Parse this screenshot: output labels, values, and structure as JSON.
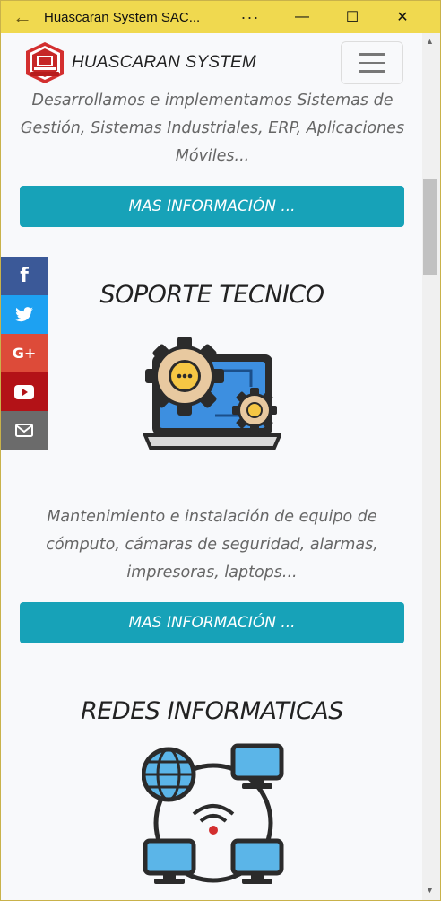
{
  "window": {
    "title": "Huascaran System SAC...",
    "more": "···",
    "minimize": "—",
    "maximize": "☐",
    "close": "✕",
    "back": "←"
  },
  "navbar": {
    "brand": "HUASCARAN SYSTEM",
    "logo_text": "HUASCARAN SYSTEM",
    "menu_icon": "hamburger-icon"
  },
  "sections": [
    {
      "description": "Desarrollamos e implementamos Sistemas de Gestión, Sistemas Industriales, ERP, Aplicaciones Móviles...",
      "button_label": "MAS INFORMACIÓN ..."
    },
    {
      "title": "SOPORTE TECNICO",
      "description": "Mantenimiento e instalación de equipo de cómputo, cámaras de seguridad, alarmas, impresoras, laptops...",
      "button_label": "MAS INFORMACIÓN ...",
      "illustration": "laptop-gears-icon"
    },
    {
      "title": "REDES INFORMATICAS",
      "illustration": "network-icon"
    }
  ],
  "social": [
    {
      "name": "facebook",
      "glyph": "f",
      "color": "#3b5998"
    },
    {
      "name": "twitter",
      "glyph": "twitter-icon",
      "color": "#1da1f2"
    },
    {
      "name": "google-plus",
      "glyph": "G+",
      "color": "#dd4b39"
    },
    {
      "name": "youtube",
      "glyph": "youtube-icon",
      "color": "#b31217"
    },
    {
      "name": "email",
      "glyph": "envelope-icon",
      "color": "#6b6b6b"
    }
  ],
  "colors": {
    "titlebar": "#f0d94f",
    "accent": "#17a2b8",
    "page_bg": "#f8f9fb"
  }
}
